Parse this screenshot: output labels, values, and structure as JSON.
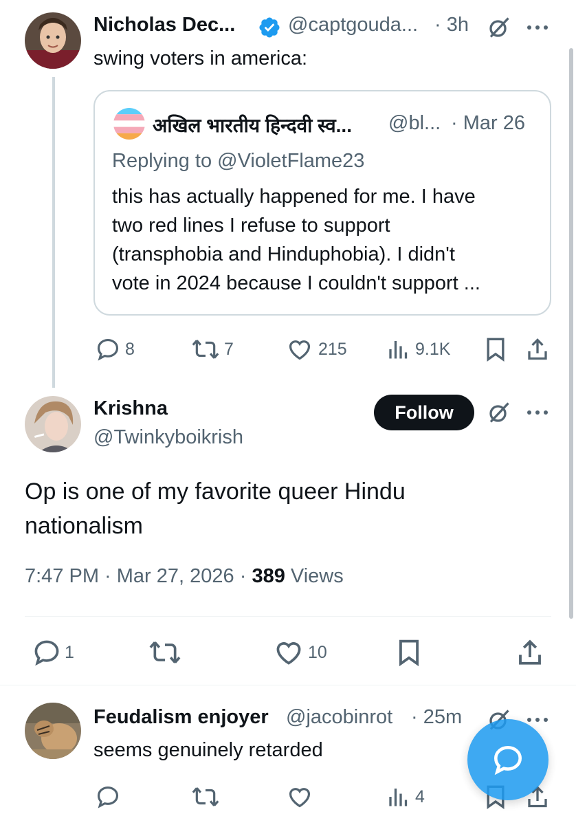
{
  "tweet1": {
    "author_name": "Nicholas Dec...",
    "author_handle": "@captgouda...",
    "time": "· 3h",
    "text": "swing voters in america:",
    "quote": {
      "author_name": "अखिल भारतीय हिन्दवी स्व...",
      "author_handle": "@bl...",
      "time": "· Mar 26",
      "replying_to": "Replying to @VioletFlame23",
      "text_lines": [
        "this has actually happened for me. I have",
        "two red lines I refuse to support",
        "(transphobia and Hinduphobia). I didn't",
        "vote in 2024 because I couldn't support ..."
      ]
    },
    "actions": {
      "replies": "8",
      "reposts": "7",
      "likes": "215",
      "views": "9.1K"
    }
  },
  "main_tweet": {
    "author_name": "Krishna",
    "author_handle": "@Twinkyboikrish",
    "follow_label": "Follow",
    "text_lines": [
      "Op is one of my favorite queer Hindu",
      "nationalism"
    ],
    "time": "7:47 PM · Mar 27, 2026 · ",
    "views_count": "389",
    "views_label": " Views",
    "actions": {
      "replies": "1",
      "likes": "10"
    }
  },
  "reply": {
    "author_name": "Feudalism enjoyer",
    "author_handle": "@jacobinrot",
    "time": "· 25m",
    "text": "seems genuinely retarded",
    "actions": {
      "views": "4"
    }
  },
  "colors": {
    "accent": "#1d9bf0",
    "verified": "#1d9bf0",
    "text": "#0f1419",
    "muted": "#536471"
  },
  "icons": [
    "verified-badge-icon",
    "grok-icon",
    "more-icon",
    "reply-icon",
    "repost-icon",
    "like-icon",
    "views-icon",
    "bookmark-icon",
    "share-icon",
    "compose-icon"
  ]
}
